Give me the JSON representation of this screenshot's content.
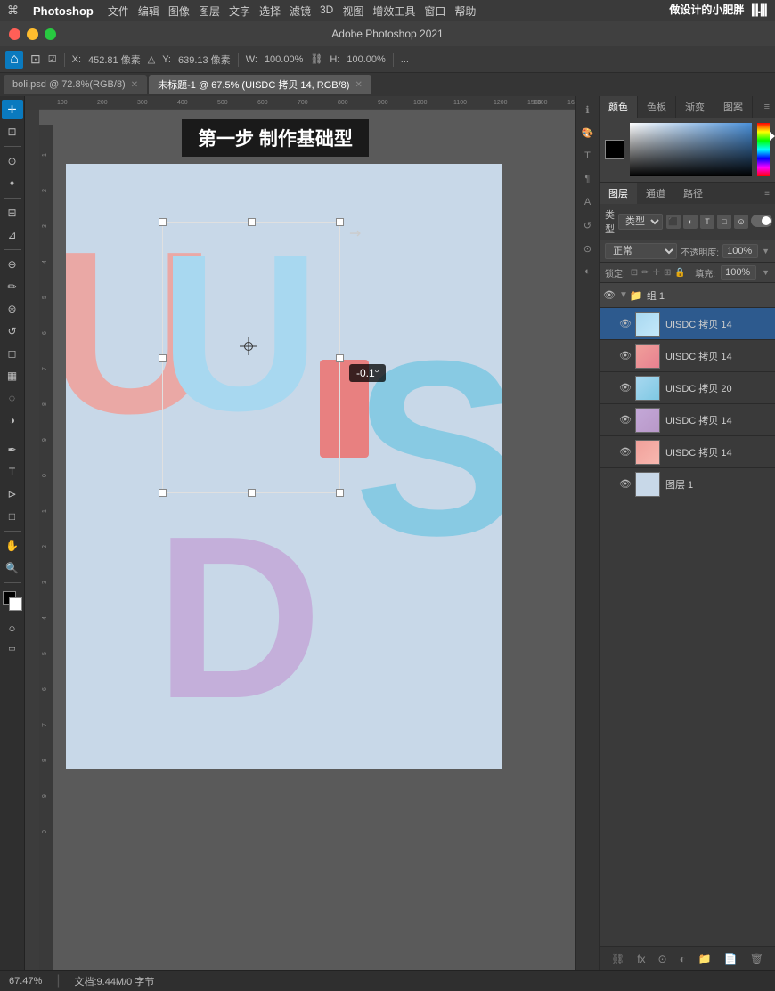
{
  "menubar": {
    "apple": "⌘",
    "app_name": "Photoshop",
    "menus": [
      "文件",
      "编辑",
      "图像",
      "图层",
      "文字",
      "选择",
      "滤镜",
      "3D",
      "视图",
      "增效工具",
      "窗口",
      "帮助"
    ],
    "title": "Adobe Photoshop 2021",
    "watermark": "做设计的小肥胖"
  },
  "window_controls": {
    "close_label": "",
    "min_label": "",
    "max_label": ""
  },
  "options_bar": {
    "x_label": "X:",
    "x_value": "452.81 像素",
    "y_label": "Y:",
    "y_value": "639.13 像素",
    "w_label": "W:",
    "w_value": "100.00%",
    "h_label": "H:",
    "h_value": "100.00%"
  },
  "tabs": [
    {
      "label": "boli.psd @ 72.8%(RGB/8)",
      "active": false
    },
    {
      "label": "未标题-1 @ 67.5% (UISDC 拷贝 14, RGB/8)",
      "active": true
    }
  ],
  "tutorial": {
    "banner_text": "第一步 制作基础型"
  },
  "canvas": {
    "background": "#c8d8e8",
    "angle_tooltip": "-0.1°",
    "letters": {
      "u_back_color": "#f0a09a",
      "s_color": "#7ec8e3",
      "d_color": "#c4a8d8",
      "u_selected_color": "#a8d8f0",
      "pink_rect_color": "#e88080"
    }
  },
  "color_panel": {
    "tabs": [
      "颜色",
      "色板",
      "渐变",
      "图案"
    ],
    "active_tab": "颜色"
  },
  "layers_panel": {
    "tabs": [
      "图层",
      "通道",
      "路径"
    ],
    "active_tab": "图层",
    "kind_label": "类型",
    "blend_mode": "正常",
    "opacity_label": "不透明度:",
    "opacity_value": "100%",
    "lock_label": "锁定:",
    "fill_label": "填充:",
    "fill_value": "100%",
    "group_name": "组 1",
    "layers": [
      {
        "name": "UISDC 拷贝 14",
        "thumb": "thumb-usdc-14a",
        "selected": true
      },
      {
        "name": "UISDC 拷贝 14",
        "thumb": "thumb-usdc-14b",
        "selected": false
      },
      {
        "name": "UISDC 拷贝 20",
        "thumb": "thumb-usdc-20",
        "selected": false
      },
      {
        "name": "UISDC 拷贝 14",
        "thumb": "thumb-usdc-14c",
        "selected": false
      },
      {
        "name": "UISDC 拷贝 14",
        "thumb": "thumb-usdc-14d",
        "selected": false
      },
      {
        "name": "图层 1",
        "thumb": "thumb-layer1",
        "selected": false
      }
    ]
  },
  "status_bar": {
    "zoom": "67.47%",
    "doc_info": "文档:9.44M/0 字节"
  }
}
